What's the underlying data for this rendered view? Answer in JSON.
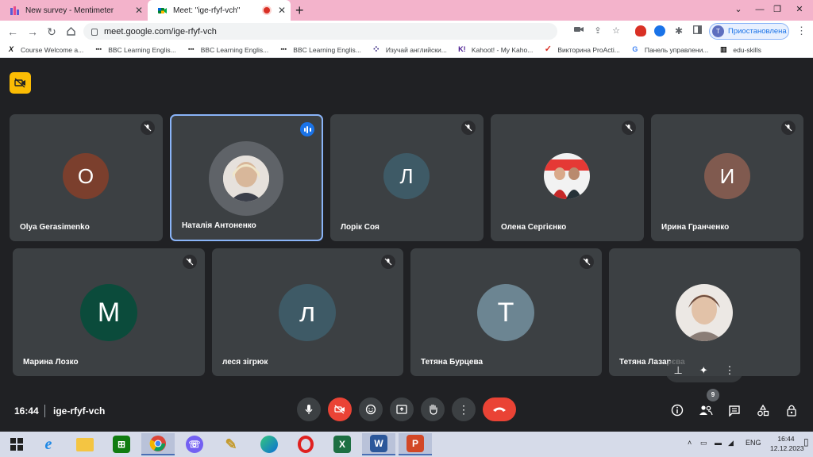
{
  "browser": {
    "tabs": [
      {
        "title": "New survey - Mentimeter",
        "active": false,
        "favicon": "mentimeter-icon",
        "color": "#e84a8a"
      },
      {
        "title": "Meet: \"ige-rfyf-vch\"",
        "active": true,
        "favicon": "google-meet-icon",
        "recording": true
      }
    ],
    "url": "meet.google.com/ige-rfyf-vch",
    "profile": {
      "initial": "T",
      "status": "Приостановлена"
    },
    "bookmarks": [
      {
        "label": "Course Welcome a...",
        "icon": "x-icon",
        "glyph": "X"
      },
      {
        "label": "BBC Learning Englis...",
        "icon": "bbc-icon",
        "glyph": "▪▪▪"
      },
      {
        "label": "BBC Learning Englis...",
        "icon": "bbc-icon",
        "glyph": "▪▪▪"
      },
      {
        "label": "BBC Learning Englis...",
        "icon": "bbc-icon",
        "glyph": "▪▪▪"
      },
      {
        "label": "Изучай английски...",
        "icon": "dots-icon",
        "glyph": "⁘"
      },
      {
        "label": "Kahoot! - My Kaho...",
        "icon": "kahoot-icon",
        "glyph": "K!"
      },
      {
        "label": "Викторина ProActi...",
        "icon": "check-icon",
        "glyph": "✓"
      },
      {
        "label": "Панель управлени...",
        "icon": "google-icon",
        "glyph": "G"
      },
      {
        "label": "edu-skills",
        "icon": "book-icon",
        "glyph": "▥"
      }
    ]
  },
  "meeting": {
    "time": "16:44",
    "code": "ige-rfyf-vch",
    "participants_count": "9",
    "participants": [
      {
        "name": "Olya Gerasimenko",
        "initial": "O",
        "color": "#7b3f2d",
        "muted": true
      },
      {
        "name": "Наталія Антоненко",
        "initial": "",
        "photo": true,
        "speaking": true,
        "muted": false
      },
      {
        "name": "Лорік Соя",
        "initial": "Л",
        "color": "#3e5a66",
        "muted": true
      },
      {
        "name": "Олена Сергієнко",
        "initial": "",
        "photo": true,
        "muted": true
      },
      {
        "name": "Ирина Гранченко",
        "initial": "И",
        "color": "#805a4f",
        "muted": true
      },
      {
        "name": "Марина Лозко",
        "initial": "М",
        "color": "#0b4b3b",
        "muted": true
      },
      {
        "name": "леся зігрюк",
        "initial": "л",
        "color": "#3e5a66",
        "muted": true
      },
      {
        "name": "Тетяна Бурцева",
        "initial": "Т",
        "color": "#6c8592",
        "muted": true
      },
      {
        "name": "Тетяна Лазарєва",
        "initial": "",
        "photo": true,
        "muted": false
      }
    ]
  },
  "taskbar": {
    "apps": [
      "windows-start-icon",
      "internet-explorer-icon",
      "file-explorer-icon",
      "store-icon",
      "chrome-icon",
      "viber-icon",
      "paint-brush-icon",
      "edge-icon",
      "opera-icon",
      "excel-icon",
      "word-icon",
      "powerpoint-icon"
    ],
    "language": "ENG",
    "time": "16:44",
    "date": "12.12.2023"
  },
  "colors": {
    "meet_bg": "#202124",
    "tile_bg": "#3c4043",
    "leave_red": "#ea4335",
    "speaking_blue": "#8ab4f8",
    "tab_strip": "#f3b3cb"
  }
}
